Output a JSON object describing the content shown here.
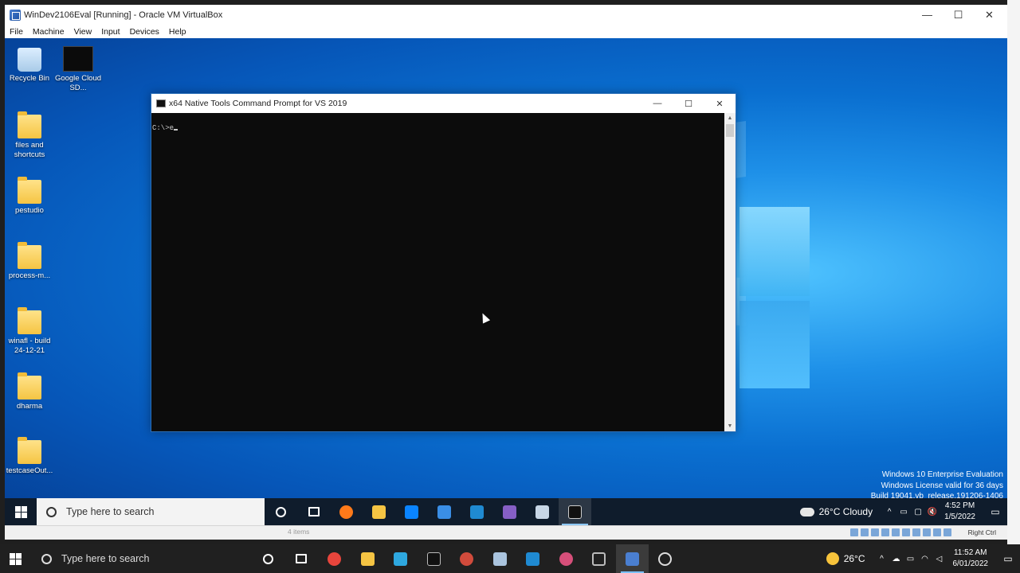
{
  "host_window": {
    "title": "WinDev2106Eval [Running] - Oracle VM VirtualBox",
    "controls": {
      "minimize": "—",
      "maximize": "☐",
      "close": "✕"
    },
    "menu": [
      "File",
      "Machine",
      "View",
      "Input",
      "Devices",
      "Help"
    ]
  },
  "desktop_icons": [
    {
      "label": "Recycle Bin",
      "icon": "recycle-bin-icon"
    },
    {
      "label": "Google Cloud SD...",
      "icon": "terminal-shortcut-icon"
    },
    {
      "label": "files and shortcuts",
      "icon": "folder-icon"
    },
    {
      "label": "pestudio",
      "icon": "folder-icon"
    },
    {
      "label": "process-m...",
      "icon": "folder-icon"
    },
    {
      "label": "winafl - build 24-12-21",
      "icon": "folder-icon"
    },
    {
      "label": "dharma",
      "icon": "folder-icon"
    },
    {
      "label": "testcaseOut...",
      "icon": "folder-icon"
    }
  ],
  "cmd_window": {
    "title": "x64 Native Tools Command Prompt for VS 2019",
    "prompt": "C:\\>e",
    "controls": {
      "minimize": "—",
      "maximize": "☐",
      "close": "✕"
    }
  },
  "watermark": {
    "line1": "Windows 10 Enterprise Evaluation",
    "line2": "Windows License valid for 36 days",
    "line3": "Build 19041.vb_release.191206-1406"
  },
  "guest_taskbar": {
    "search_placeholder": "Type here to search",
    "apps": [
      {
        "name": "cortana-icon",
        "color": "#ffffff"
      },
      {
        "name": "task-view-icon",
        "color": "#ffffff"
      },
      {
        "name": "firefox-icon",
        "color": "#ff7a1a"
      },
      {
        "name": "file-explorer-icon",
        "color": "#f5c443"
      },
      {
        "name": "store-icon",
        "color": "#0a84ff"
      },
      {
        "name": "mail-icon",
        "color": "#3a8ee6"
      },
      {
        "name": "vscode-icon",
        "color": "#1f8ad2"
      },
      {
        "name": "visual-studio-icon",
        "color": "#865fc5"
      },
      {
        "name": "notepad-icon",
        "color": "#c7d6e6"
      },
      {
        "name": "cmd-icon",
        "color": "#111111"
      }
    ],
    "weather": "26°C  Cloudy",
    "time": "4:52 PM",
    "date": "1/5/2022",
    "tray_glyphs": [
      "^",
      "▭",
      "▢",
      "🔇"
    ]
  },
  "vbox_status": {
    "items_text": "4 items",
    "host_key": "Right Ctrl"
  },
  "host_taskbar": {
    "search_placeholder": "Type here to search",
    "apps": [
      {
        "name": "cortana-icon",
        "color": "#ffffff"
      },
      {
        "name": "task-view-icon",
        "color": "#ffffff"
      },
      {
        "name": "chrome-icon",
        "color": "#e8453c"
      },
      {
        "name": "file-explorer-icon",
        "color": "#f5c443"
      },
      {
        "name": "todo-icon",
        "color": "#2ea8e0"
      },
      {
        "name": "terminal-icon",
        "color": "#111111"
      },
      {
        "name": "chrome-profile-icon",
        "color": "#d14b3c"
      },
      {
        "name": "notepad-icon",
        "color": "#aac4de"
      },
      {
        "name": "vscode-icon",
        "color": "#1f8ad2"
      },
      {
        "name": "chrome-canary-icon",
        "color": "#d64f7a"
      },
      {
        "name": "3d-viewer-icon",
        "color": "#bbbbbb"
      },
      {
        "name": "virtualbox-icon",
        "color": "#4a7fd1"
      },
      {
        "name": "obs-icon",
        "color": "#dddddd"
      }
    ],
    "weather": "26°C",
    "time": "11:52 AM",
    "date": "6/01/2022"
  }
}
